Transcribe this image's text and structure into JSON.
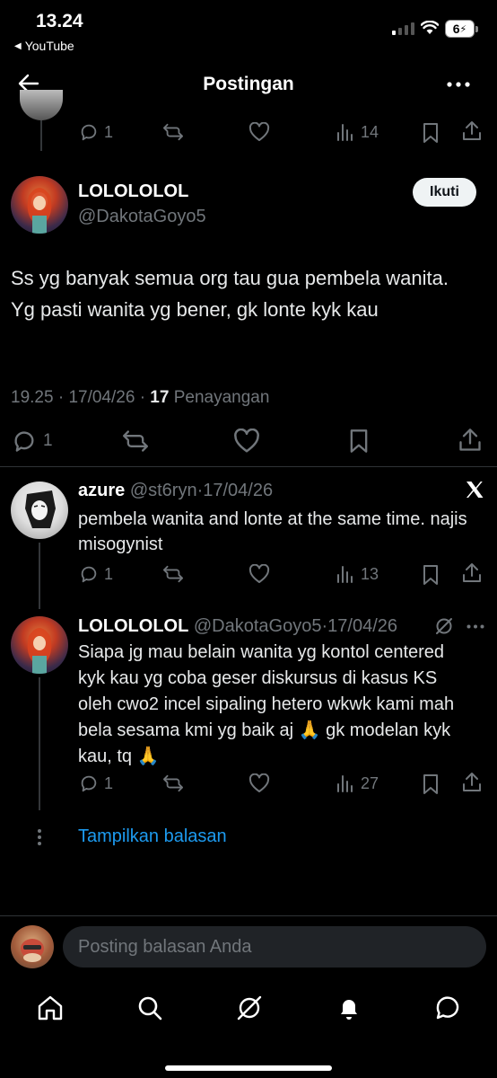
{
  "status_bar": {
    "time": "13.24",
    "back_app": "YouTube",
    "battery": "6"
  },
  "header": {
    "title": "Postingan"
  },
  "prev_reply": {
    "reply_count": "1",
    "views": "14"
  },
  "main_post": {
    "display_name": "LOLOLOLOL",
    "handle": "@DakotaGoyo5",
    "follow_label": "Ikuti",
    "text": "Ss yg banyak semua org tau gua pembela wanita. Yg pasti wanita yg bener, gk lonte kyk kau",
    "time": "19.25",
    "date": "17/04/26",
    "views_count": "17",
    "views_label": "Penayangan",
    "reply_count": "1"
  },
  "replies": [
    {
      "display_name": "azure",
      "handle": "@st6ryn",
      "date": "17/04/26",
      "text": "pembela wanita and lonte at the same time. najis misogynist",
      "reply_count": "1",
      "views": "13"
    },
    {
      "display_name": "LOLOLOLOL",
      "handle": "@DakotaGoyo5",
      "date": "17/04/26",
      "text": "Siapa jg mau belain wanita yg kontol centered kyk kau yg coba geser diskursus di kasus KS oleh cwo2 incel sipaling hetero wkwk kami mah bela sesama kmi yg baik aj 🙏  gk modelan kyk kau, tq 🙏",
      "reply_count": "1",
      "views": "27"
    }
  ],
  "show_replies_label": "Tampilkan balasan",
  "composer": {
    "placeholder": "Posting balasan Anda"
  },
  "colors": {
    "background": "#000000",
    "accent": "#1d9bf0",
    "muted": "#71767b",
    "text": "#e7e9ea"
  }
}
